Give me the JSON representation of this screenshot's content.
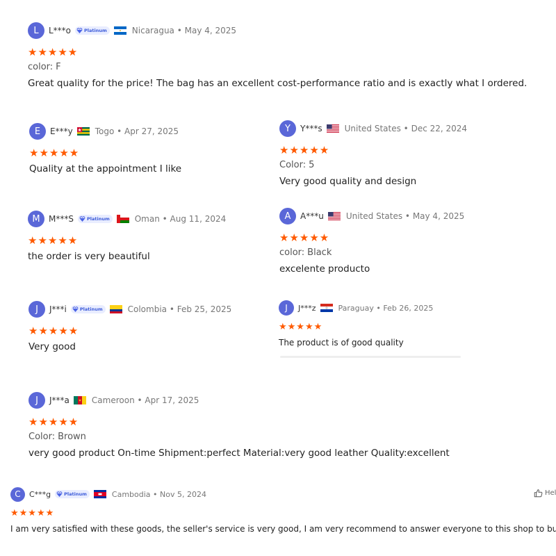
{
  "colors": {
    "star": "#ff5a00",
    "avatar": "#5a67d8",
    "badge_bg": "#e9edff",
    "badge_text": "#3c5bd9"
  },
  "reviews": [
    {
      "initial": "L",
      "name": "L***o",
      "badge": "Platinum",
      "flag": "nicaragua",
      "country": "Nicaragua",
      "date": "May 4, 2025",
      "rating": 5,
      "variant_label": "color:",
      "variant_value": "F",
      "text": "Great quality for the price! The bag has an excellent cost-performance ratio and is exactly what I ordered."
    },
    {
      "initial": "E",
      "name": "E***y",
      "flag": "togo",
      "country": "Togo",
      "date": "Apr 27, 2025",
      "rating": 5,
      "text": "Quality at the appointment I like"
    },
    {
      "initial": "Y",
      "name": "Y***s",
      "flag": "usa",
      "country": "United States",
      "date": "Dec 22, 2024",
      "rating": 5,
      "variant_label": "Color:",
      "variant_value": "5",
      "text": "Very good quality and design"
    },
    {
      "initial": "M",
      "name": "M***S",
      "badge": "Platinum",
      "flag": "oman",
      "country": "Oman",
      "date": "Aug 11, 2024",
      "rating": 5,
      "text": "the order is very beautiful"
    },
    {
      "initial": "A",
      "name": "A***u",
      "flag": "usa",
      "country": "United States",
      "date": "May 4, 2025",
      "rating": 5,
      "variant_label": "color:",
      "variant_value": "Black",
      "text": "excelente producto"
    },
    {
      "initial": "J",
      "name": "J***i",
      "badge": "Platinum",
      "flag": "colombia",
      "country": "Colombia",
      "date": "Feb 25, 2025",
      "rating": 5,
      "text": "Very good"
    },
    {
      "initial": "J",
      "name": "J***z",
      "flag": "paraguay",
      "country": "Paraguay",
      "date": "Feb 26, 2025",
      "rating": 5,
      "text": "The product is of good quality"
    },
    {
      "initial": "J",
      "name": "J***a",
      "flag": "cameroon",
      "country": "Cameroon",
      "date": "Apr 17, 2025",
      "rating": 5,
      "variant_label": "Color:",
      "variant_value": "Brown",
      "text": "very good product On-time Shipment:perfect Material:very good leather Quality:excellent"
    },
    {
      "initial": "C",
      "name": "C***g",
      "badge": "Platinum",
      "flag": "cambodia",
      "country": "Cambodia",
      "date": "Nov 5, 2024",
      "rating": 5,
      "text": "I am very satisfied with these goods, the seller's service is very good, I am very recommend to answer everyone to this shop to buy"
    }
  ],
  "helpful_label": "Hel"
}
